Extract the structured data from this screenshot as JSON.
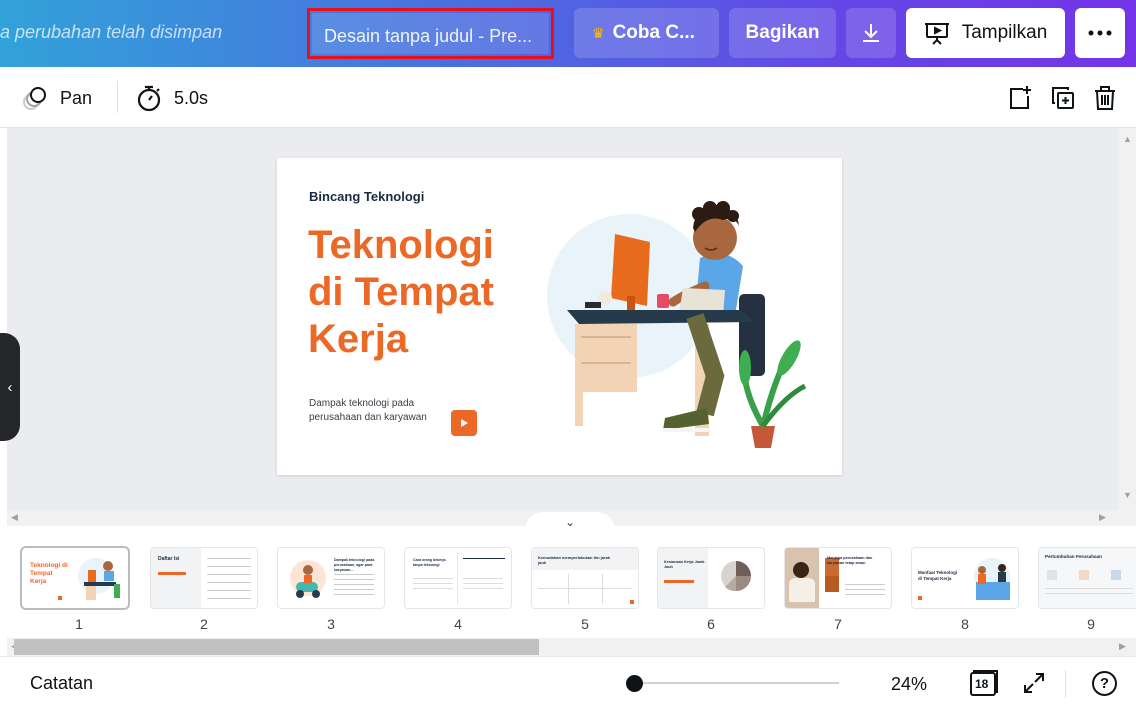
{
  "topbar": {
    "saved_message": "a perubahan telah disimpan",
    "design_title": "Desain tanpa judul - Pre...",
    "try_button": "Coba C...",
    "share_button": "Bagikan",
    "present_button": "Tampilkan",
    "icons": [
      "crown-icon",
      "download-icon",
      "present-icon",
      "more-icon"
    ]
  },
  "toolbar": {
    "animate_label": "Pan",
    "duration_label": "5.0s",
    "icons": [
      "pan-animation-icon",
      "timer-icon",
      "add-page-icon",
      "duplicate-page-icon",
      "delete-page-icon"
    ]
  },
  "slide": {
    "kicker": "Bincang Teknologi",
    "title": "Teknologi di Tempat Kerja",
    "subtitle": "Dampak teknologi pada perusahaan dan karyawan",
    "accent_color": "#ec6826"
  },
  "thumbnails": {
    "items": [
      {
        "number": "1",
        "title": "Teknologi di Tempat Kerja"
      },
      {
        "number": "2",
        "title": "Daftar Isi"
      },
      {
        "number": "3",
        "title": "Dampak teknologi pada perusahaan, agar para karyawan..."
      },
      {
        "number": "4",
        "title": "Cara orang bekerja tanpa teknologi"
      },
      {
        "number": "5",
        "title": "Kemudahan memperlakukan tim jarak jauh"
      },
      {
        "number": "6",
        "title": "Kesamaan Kerja Jarak Jauh"
      },
      {
        "number": "7",
        "title": "Menjaga perusahaan dan karyawan tetap aman"
      },
      {
        "number": "8",
        "title": "Manfaat Teknologi di Tempat Kerja"
      },
      {
        "number": "9",
        "title": "Pertumbuhan Perusahaan"
      }
    ]
  },
  "footer": {
    "notes_label": "Catatan",
    "zoom_level": "24%",
    "page_count": "18",
    "help_label": "?"
  }
}
